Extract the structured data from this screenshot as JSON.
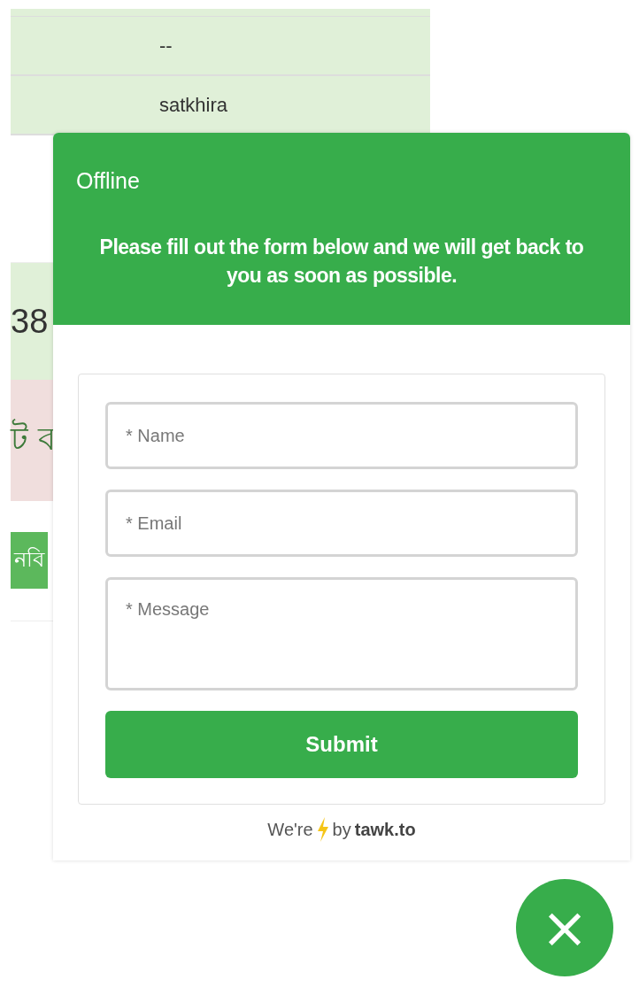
{
  "background_page": {
    "rows": [
      {
        "kind": "cell",
        "text": "--"
      },
      {
        "kind": "cell",
        "text": "satkhira"
      },
      {
        "kind": "blank"
      },
      {
        "kind": "number",
        "text": "38"
      },
      {
        "kind": "notice",
        "text": "ট ব"
      },
      {
        "kind": "action",
        "text": "নবি"
      }
    ]
  },
  "chat_widget": {
    "status": "Offline",
    "message": "Please fill out the form below and we will get back to you as soon as possible.",
    "fields": [
      {
        "kind": "input",
        "placeholder": "* Name"
      },
      {
        "kind": "input",
        "placeholder": "* Email"
      },
      {
        "kind": "textarea",
        "placeholder": "* Message"
      }
    ],
    "submit": "Submit",
    "footer": {
      "prefix": "We're",
      "by": "by",
      "brand": "tawk.to"
    }
  },
  "close_button": {
    "icon": "×"
  }
}
